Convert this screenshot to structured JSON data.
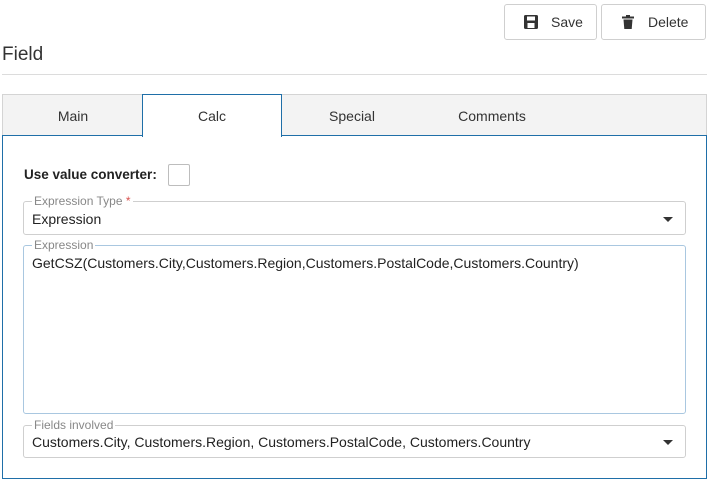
{
  "toolbar": {
    "save_label": "Save",
    "delete_label": "Delete"
  },
  "page": {
    "title": "Field"
  },
  "tabs": [
    {
      "label": "Main",
      "active": false
    },
    {
      "label": "Calc",
      "active": true
    },
    {
      "label": "Special",
      "active": false
    },
    {
      "label": "Comments",
      "active": false
    }
  ],
  "form": {
    "use_value_converter_label": "Use value converter:",
    "use_value_converter_checked": false,
    "expression_type": {
      "legend": "Expression Type",
      "required_mark": "*",
      "value": "Expression"
    },
    "expression": {
      "legend": "Expression",
      "value": "GetCSZ(Customers.City,Customers.Region,Customers.PostalCode,Customers.Country)"
    },
    "fields_involved": {
      "legend": "Fields involved",
      "value": "Customers.City, Customers.Region, Customers.PostalCode, Customers.Country"
    }
  },
  "icons": {
    "save": "floppy-disk-icon",
    "delete": "trash-icon"
  },
  "colors": {
    "accent_border": "#1f6fa8",
    "required": "#d9534f"
  }
}
